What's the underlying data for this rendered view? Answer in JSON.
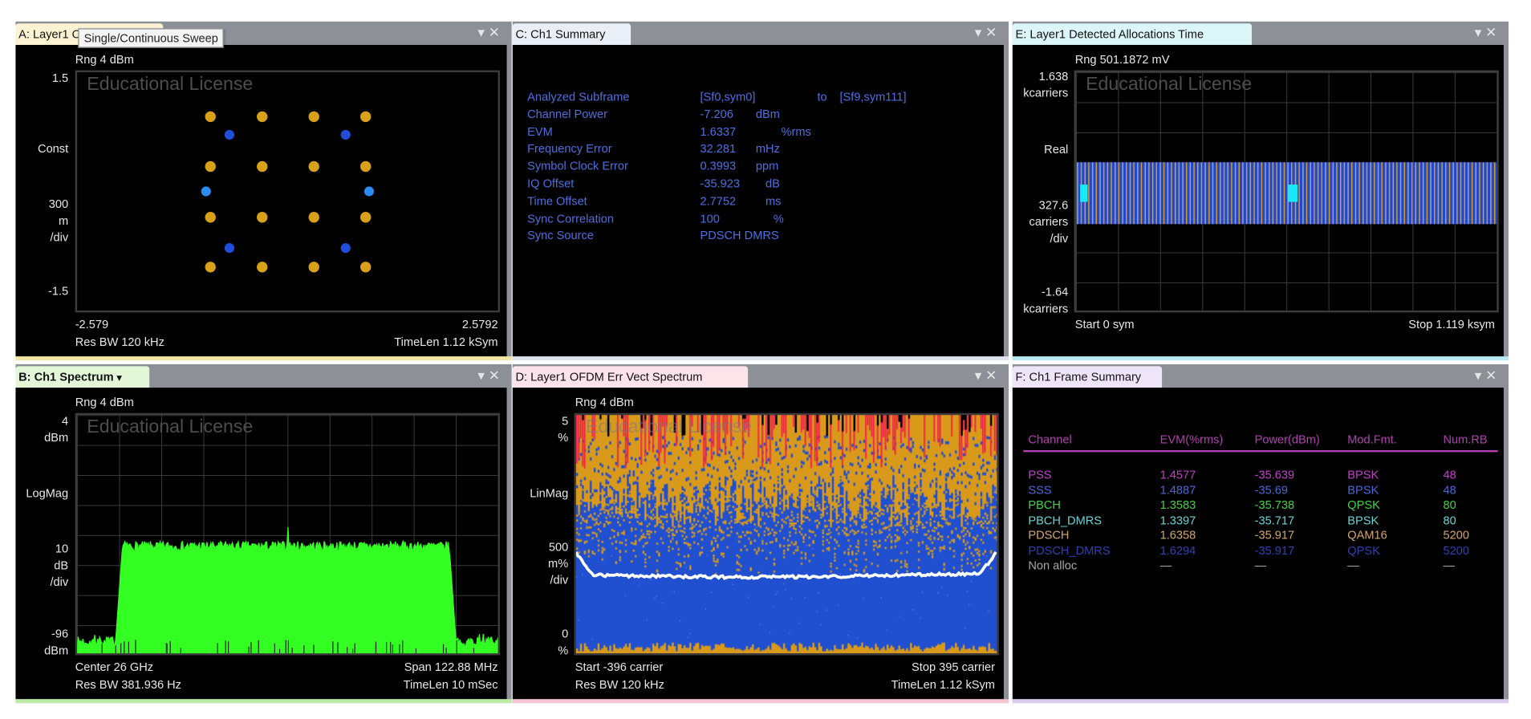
{
  "tooltip": "Single/Continuous Sweep",
  "panel_controls": {
    "dropdown": "▾",
    "close": "✕"
  },
  "watermark": "Educational License",
  "panels": {
    "A": {
      "title": "A: Layer1 OFDM Meas",
      "range": "Rng 4 dBm",
      "y_labels": {
        "top": "1.5",
        "format": "Const",
        "scale1": "300",
        "scale2": "m",
        "scale3": "/div",
        "bottom": "-1.5"
      },
      "x_start": "-2.579",
      "x_stop": "2.5792",
      "res_bw": "Res BW 120 kHz",
      "time_len": "TimeLen 1.12 kSym"
    },
    "B": {
      "title": "B: Ch1 Spectrum",
      "title_arrow": "▾",
      "range": "Rng 4 dBm",
      "y_labels": {
        "top1": "4",
        "top2": "dBm",
        "format": "LogMag",
        "scale1": "10",
        "scale2": "dB",
        "scale3": "/div",
        "bottom1": "-96",
        "bottom2": "dBm"
      },
      "center": "Center 26 GHz",
      "span": "Span 122.88 MHz",
      "res_bw": "Res BW 381.936  Hz",
      "time_len": "TimeLen 10 mSec"
    },
    "C": {
      "title": "C: Ch1 Summary",
      "rows": [
        {
          "label": "Analyzed  Subframe",
          "value": "[Sf0,sym0]",
          "unit": "to",
          "extra": "[Sf9,sym111]"
        },
        {
          "label": "Channel  Power",
          "value": "-7.206",
          "unit": "dBm"
        },
        {
          "label": "EVM",
          "value": "1.6337",
          "unit": "%rms"
        },
        {
          "label": "Frequency  Error",
          "value": "32.281",
          "unit": "mHz"
        },
        {
          "label": "Symbol  Clock  Error",
          "value": "0.3993",
          "unit": "ppm"
        },
        {
          "label": "IQ  Offset",
          "value": "-35.923",
          "unit": "dB"
        },
        {
          "label": "Time  Offset",
          "value": "2.7752",
          "unit": "ms"
        },
        {
          "label": "Sync  Correlation",
          "value": "100",
          "unit": "%"
        },
        {
          "label": "Sync  Source",
          "value": "PDSCH  DMRS",
          "unit": ""
        }
      ]
    },
    "D": {
      "title": "D: Layer1 OFDM Err Vect Spectrum",
      "range": "Rng 4 dBm",
      "y_labels": {
        "top1": "5",
        "top2": "%",
        "format": "LinMag",
        "scale1": "500",
        "scale2": "m%",
        "scale3": "/div",
        "bottom1": "0",
        "bottom2": "%"
      },
      "start": "Start -396  carrier",
      "stop": "Stop 395  carrier",
      "res_bw": "Res BW 120 kHz",
      "time_len": "TimeLen 1.12 kSym"
    },
    "E": {
      "title": "E: Layer1 Detected Allocations Time",
      "range": "Rng 501.1872 mV",
      "y_labels": {
        "top1": "1.638",
        "top2": "kcarriers",
        "format": "Real",
        "scale1": "327.6",
        "scale2": "carriers",
        "scale3": "/div",
        "bottom1": "-1.64",
        "bottom2": "kcarriers"
      },
      "start": "Start 0  sym",
      "stop": "Stop 1.119 ksym"
    },
    "F": {
      "title": "F: Ch1 Frame Summary",
      "headers": [
        "Channel",
        "EVM(%rms)",
        "Power(dBm)",
        "Mod.Fmt.",
        "Num.RB"
      ],
      "header_color": "#b040b0",
      "rows": [
        {
          "channel": "PSS",
          "evm": "1.4577",
          "power": "-35.639",
          "mod": "BPSK",
          "rb": "48",
          "color": "#c040c8"
        },
        {
          "channel": "SSS",
          "evm": "1.4887",
          "power": "-35.69",
          "mod": "BPSK",
          "rb": "48",
          "color": "#4a68d8"
        },
        {
          "channel": "PBCH",
          "evm": "1.3583",
          "power": "-35.738",
          "mod": "QPSK",
          "rb": "80",
          "color": "#48d048"
        },
        {
          "channel": "PBCH_DMRS",
          "evm": "1.3397",
          "power": "-35.717",
          "mod": "BPSK",
          "rb": "80",
          "color": "#68d4d4"
        },
        {
          "channel": "PDSCH",
          "evm": "1.6358",
          "power": "-35.917",
          "mod": "QAM16",
          "rb": "5200",
          "color": "#d4a66a"
        },
        {
          "channel": "PDSCH_DMRS",
          "evm": "1.6294",
          "power": "-35.917",
          "mod": "QPSK",
          "rb": "5200",
          "color": "#3040b0"
        },
        {
          "channel": "Non alloc",
          "evm": "—",
          "power": "—",
          "mod": "—",
          "rb": "—",
          "color": "#a8a8a8"
        }
      ]
    }
  },
  "chart_data": [
    {
      "id": "A",
      "type": "scatter",
      "title": "Layer1 OFDM Meas (constellation)",
      "xlim": [
        -2.579,
        2.5792
      ],
      "ylim": [
        -1.5,
        1.5
      ],
      "series": [
        {
          "name": "QAM16",
          "color": "#d9a11a",
          "points": [
            [
              -0.949,
              0.949
            ],
            [
              -0.316,
              0.949
            ],
            [
              0.316,
              0.949
            ],
            [
              0.949,
              0.949
            ],
            [
              -0.949,
              0.316
            ],
            [
              -0.316,
              0.316
            ],
            [
              0.316,
              0.316
            ],
            [
              0.949,
              0.316
            ],
            [
              -0.949,
              -0.316
            ],
            [
              -0.316,
              -0.316
            ],
            [
              0.316,
              -0.316
            ],
            [
              0.949,
              -0.316
            ],
            [
              -0.949,
              -0.949
            ],
            [
              -0.316,
              -0.949
            ],
            [
              0.316,
              -0.949
            ],
            [
              0.949,
              -0.949
            ]
          ]
        },
        {
          "name": "QPSK",
          "color": "#1f4fd8",
          "points": [
            [
              -0.707,
              0.707
            ],
            [
              0.707,
              0.707
            ],
            [
              -0.707,
              -0.707
            ],
            [
              0.707,
              -0.707
            ]
          ]
        },
        {
          "name": "BPSK",
          "color": "#2a8cf0",
          "points": [
            [
              -1,
              0
            ],
            [
              1,
              0
            ]
          ]
        }
      ]
    },
    {
      "id": "B",
      "type": "line",
      "title": "Ch1 Spectrum",
      "x_center_ghz": 26,
      "x_span_mhz": 122.88,
      "ylim": [
        -96,
        4
      ],
      "yunit": "dBm",
      "band_edges_mhz": [
        -49,
        48
      ],
      "band_level_dbm": -51,
      "noise_floor_dbm": -91,
      "spike": {
        "offset_mhz": 0.2,
        "level_dbm": -43
      },
      "color": "#33ff22"
    },
    {
      "id": "D",
      "type": "scatter",
      "title": "Layer1 OFDM Err Vect Spectrum",
      "xlim": [
        -396,
        395
      ],
      "ylim": [
        0,
        5
      ],
      "yunit": "%",
      "average_trace": {
        "center_level": 1.65,
        "edge_level": 2.1,
        "color": "#ffffff"
      },
      "colors": {
        "pdsch": "#2050d0",
        "qam": "#d99a1c",
        "peak": "#f0204a"
      }
    },
    {
      "id": "E",
      "type": "heatmap",
      "title": "Layer1 Detected Allocations Time",
      "xlim": [
        0,
        1119
      ],
      "xunit": "sym",
      "ylim": [
        -1.638,
        1.638
      ],
      "yunit": "kcarriers",
      "allocation_band_kcarriers": [
        -0.45,
        0.4
      ],
      "stripe_count": 112,
      "markers_sym": [
        [
          11,
          31
        ],
        [
          563,
          589
        ]
      ],
      "colors": {
        "base": "#2448c8",
        "stripe_a": "#9aa6c0",
        "stripe_b": "#d09a30",
        "marker": "#18e8f8"
      }
    }
  ]
}
